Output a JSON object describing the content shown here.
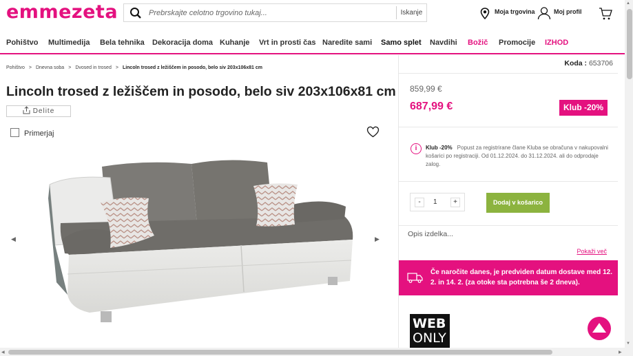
{
  "header": {
    "logo": "emmezeta",
    "search_placeholder": "Prebrskajte celotno trgovino tukaj...",
    "search_button": "Iskanje",
    "store_link": "Moja trgovina",
    "profile_link": "Moj profil",
    "icons": [
      "search-icon",
      "location-pin-icon",
      "user-icon",
      "cart-icon"
    ]
  },
  "nav": {
    "items": [
      "Pohištvo",
      "Multimedija",
      "Bela tehnika",
      "Dekoracija doma",
      "Kuhanje",
      "Vrt in prosti čas",
      "Naredite sami",
      "Samo splet",
      "Navdihi",
      "Božič",
      "Promocije",
      "IZHOD"
    ]
  },
  "breadcrumb": [
    "Pohištvo",
    "Dnevna soba",
    "Dvosed in trosed",
    "Lincoln trosed z ležiščem in posodo, belo siv 203x106x81 cm"
  ],
  "product": {
    "title": "Lincoln trosed z ležiščem in posodo, belo siv 203x106x81 cm",
    "share_label": "Delite",
    "compare_label": "Primerjaj",
    "code_label": "Koda :",
    "code_value": "653706",
    "old_price": "859,99 €",
    "price": "687,99 €",
    "klub_badge": "Klub -20%",
    "info_bold": "Klub -20%",
    "info_text": "Popust za registrirane člane Kluba se obračuna v nakupovalni košarici po registraciji. Od 01.12.2024. do 31.12.2024. ali do odprodaje zalog.",
    "qty_minus": "-",
    "qty_value": "1",
    "qty_plus": "+",
    "add_to_cart": "Dodaj v košarico",
    "description": "Opis izdelka...",
    "show_more": "Pokaži več",
    "delivery_text": "Če naročite danes, je predviden datum dostave med 12. 2. in 14. 2. (za otoke sta potrebna še 2 dneva).",
    "web_line1": "WEB",
    "web_line2": "ONLY"
  },
  "colors": {
    "brand": "#e4117f",
    "cart_button": "#8cb33f"
  }
}
